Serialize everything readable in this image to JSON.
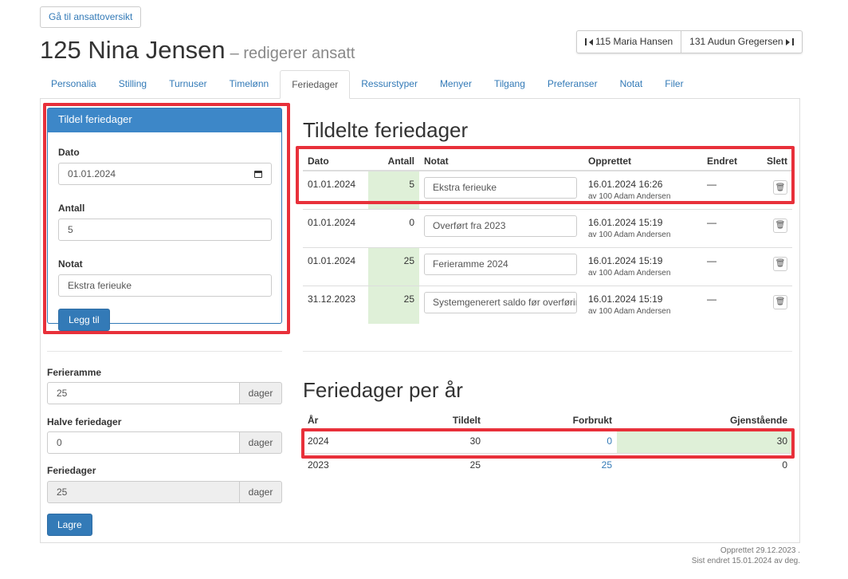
{
  "back_button": "Gå til ansattoversikt",
  "title": {
    "name": "125 Nina Jensen",
    "subtitle": "– redigerer ansatt"
  },
  "employee_nav": {
    "prev": "115 Maria Hansen",
    "next": "131 Audun Gregersen"
  },
  "tabs": [
    {
      "label": "Personalia"
    },
    {
      "label": "Stilling"
    },
    {
      "label": "Turnuser"
    },
    {
      "label": "Timelønn"
    },
    {
      "label": "Feriedager",
      "active": true
    },
    {
      "label": "Ressurstyper"
    },
    {
      "label": "Menyer"
    },
    {
      "label": "Tilgang"
    },
    {
      "label": "Preferanser"
    },
    {
      "label": "Notat"
    },
    {
      "label": "Filer"
    }
  ],
  "assign_panel": {
    "heading": "Tildel feriedager",
    "date_label": "Dato",
    "date_value": "01.01.2024",
    "count_label": "Antall",
    "count_value": "5",
    "note_label": "Notat",
    "note_value": "Ekstra ferieuke",
    "add_button": "Legg til"
  },
  "assigned": {
    "heading": "Tildelte feriedager",
    "columns": {
      "date": "Dato",
      "count": "Antall",
      "note": "Notat",
      "created": "Opprettet",
      "changed": "Endret",
      "delete": "Slett"
    },
    "rows": [
      {
        "date": "01.01.2024",
        "count": "5",
        "note": "Ekstra ferieuke",
        "created": "16.01.2024 16:26",
        "by": "av 100 Adam Andersen",
        "changed": "—"
      },
      {
        "date": "01.01.2024",
        "count": "0",
        "note": "Overført fra 2023",
        "created": "16.01.2024 15:19",
        "by": "av 100 Adam Andersen",
        "changed": "—"
      },
      {
        "date": "01.01.2024",
        "count": "25",
        "note": "Ferieramme 2024",
        "created": "16.01.2024 15:19",
        "by": "av 100 Adam Andersen",
        "changed": "—"
      },
      {
        "date": "31.12.2023",
        "count": "25",
        "note": "Systemgenerert saldo før overføring",
        "created": "16.01.2024 15:19",
        "by": "av 100 Adam Andersen",
        "changed": "—"
      }
    ]
  },
  "settings": {
    "frame_label": "Ferieramme",
    "frame_value": "25",
    "half_label": "Halve feriedager",
    "half_value": "0",
    "days_label": "Feriedager",
    "days_value": "25",
    "unit": "dager",
    "save_button": "Lagre"
  },
  "per_year": {
    "heading": "Feriedager per år",
    "columns": {
      "year": "År",
      "assigned": "Tildelt",
      "used": "Forbrukt",
      "remaining": "Gjenstående"
    },
    "rows": [
      {
        "year": "2024",
        "assigned": "30",
        "used": "0",
        "remaining": "30"
      },
      {
        "year": "2023",
        "assigned": "25",
        "used": "25",
        "remaining": "0"
      }
    ]
  },
  "footer": {
    "created": "Opprettet 29.12.2023 .",
    "changed": "Sist endret 15.01.2024 av deg."
  }
}
